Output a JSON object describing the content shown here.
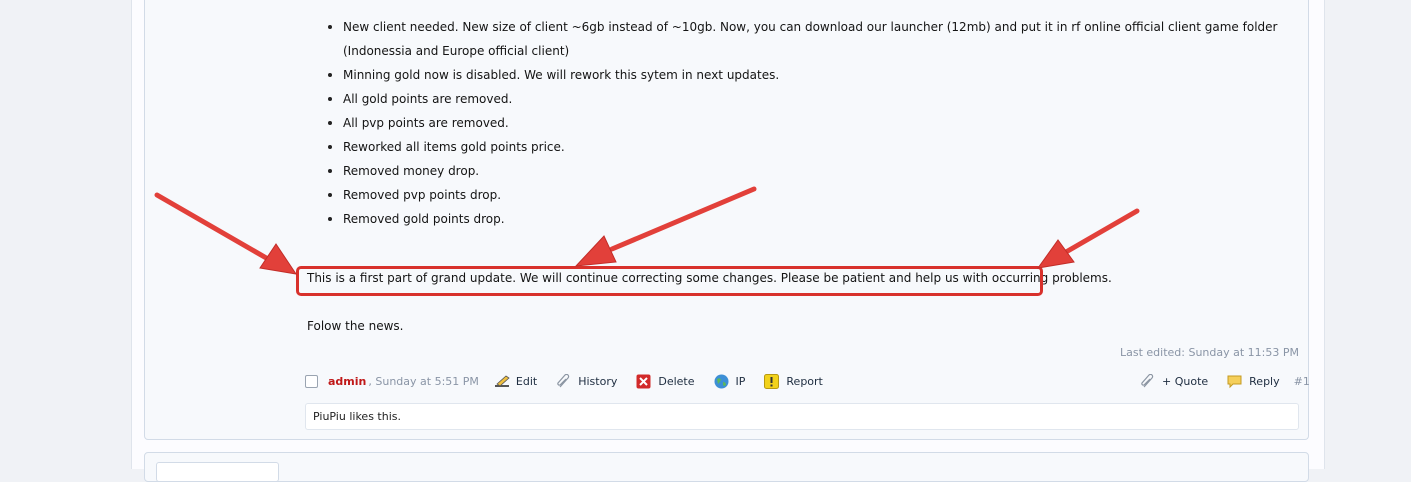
{
  "post": {
    "changes": [
      "New client needed. New size of client ~6gb instead of ~10gb. Now, you can download our launcher (12mb) and put it in rf online official client game folder (Indonessia and Europe official client)",
      "Minning gold now is disabled. We will rework this sytem in next updates.",
      "All gold points are removed.",
      "All pvp points are removed.",
      "Reworked all items gold points price.",
      "Removed money drop.",
      "Removed pvp points drop.",
      "Removed gold points drop."
    ],
    "highlighted_text": "This is a first part of grand update. We will continue correcting some changes. Please be patient and help us with occurring problems.",
    "follow_text": "Folow the news.",
    "last_edited": "Last edited: Sunday at 11:53 PM",
    "author": "admin",
    "date": ", Sunday at 5:51 PM",
    "number": "#1",
    "likes": "PiuPiu likes this."
  },
  "controls": {
    "edit": "Edit",
    "history": "History",
    "delete": "Delete",
    "ip": "IP",
    "report": "Report",
    "quote": "+ Quote",
    "reply": "Reply"
  },
  "icons": {
    "edit": "pencil-icon",
    "history": "paperclip-icon",
    "delete": "red-x-icon",
    "ip": "globe-icon",
    "report": "warning-icon",
    "quote": "paperclip-icon",
    "reply": "speech-bubble-icon"
  },
  "colors": {
    "annotation_red": "#d8312c",
    "author_red": "#c01818",
    "muted_text": "#8a95a6"
  }
}
